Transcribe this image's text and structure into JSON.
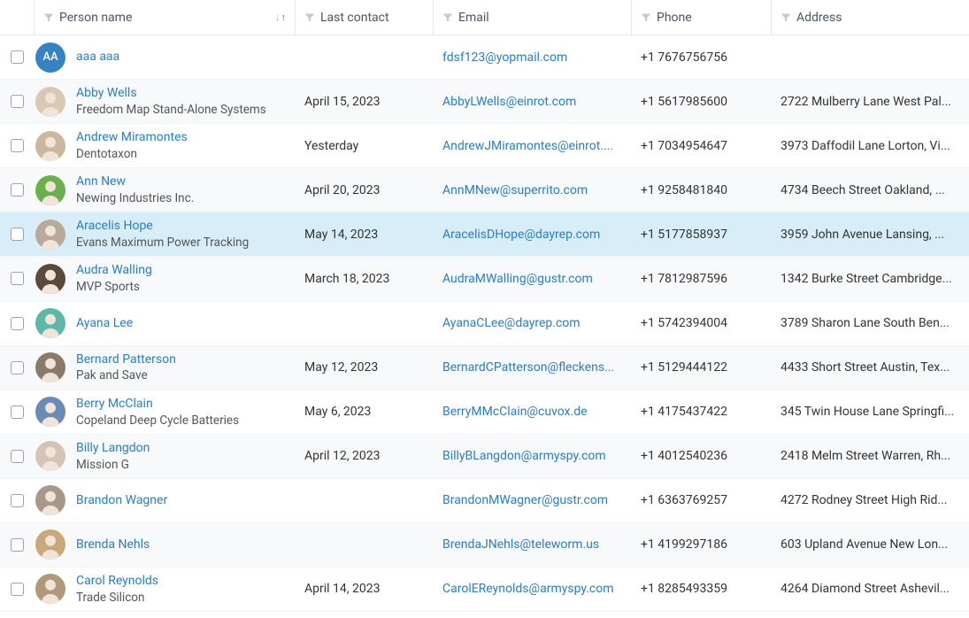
{
  "columns": {
    "person": "Person name",
    "lastContact": "Last contact",
    "email": "Email",
    "phone": "Phone",
    "address": "Address"
  },
  "rows": [
    {
      "initials": "AA",
      "avatarType": "initials",
      "avatarBg": "#3683c4",
      "name": "aaa aaa",
      "company": "",
      "lastContact": "",
      "email": "fdsf123@yopmail.com",
      "phone": "+1 7676756756",
      "address": "",
      "highlight": false
    },
    {
      "avatarType": "photo",
      "avatarBg": "#d8c9b5",
      "name": "Abby Wells",
      "company": "Freedom Map Stand-Alone Systems",
      "lastContact": "April 15, 2023",
      "email": "AbbyLWells@einrot.com",
      "phone": "+1 5617985600",
      "address": "2722 Mulberry Lane West Pal...",
      "highlight": false
    },
    {
      "avatarType": "photo",
      "avatarBg": "#c9b89e",
      "name": "Andrew Miramontes",
      "company": "Dentotaxon",
      "lastContact": "Yesterday",
      "email": "AndrewJMiramontes@einrot....",
      "phone": "+1 7034954647",
      "address": "3973 Daffodil Lane Lorton, Vi...",
      "highlight": false
    },
    {
      "avatarType": "photo",
      "avatarBg": "#6ab04c",
      "name": "Ann New",
      "company": "Newing Industries Inc.",
      "lastContact": "April 20, 2023",
      "email": "AnnMNew@superrito.com",
      "phone": "+1 9258481840",
      "address": "4734 Beech Street Oakland, ...",
      "highlight": false
    },
    {
      "avatarType": "photo",
      "avatarBg": "#b8a99a",
      "name": "Aracelis Hope",
      "company": "Evans Maximum Power Tracking",
      "lastContact": "May 14, 2023",
      "email": "AracelisDHope@dayrep.com",
      "phone": "+1 5177858937",
      "address": "3959 John Avenue Lansing, ...",
      "highlight": true
    },
    {
      "avatarType": "photo",
      "avatarBg": "#5a4a3a",
      "name": "Audra Walling",
      "company": "MVP Sports",
      "lastContact": "March 18, 2023",
      "email": "AudraMWalling@gustr.com",
      "phone": "+1 7812987596",
      "address": "1342 Burke Street Cambridge...",
      "highlight": false
    },
    {
      "avatarType": "photo",
      "avatarBg": "#5cb8a8",
      "name": "Ayana Lee",
      "company": "",
      "lastContact": "",
      "email": "AyanaCLee@dayrep.com",
      "phone": "+1 5742394004",
      "address": "3789 Sharon Lane South Ben...",
      "highlight": false
    },
    {
      "avatarType": "photo",
      "avatarBg": "#8a7a6a",
      "name": "Bernard Patterson",
      "company": "Pak and Save",
      "lastContact": "May 12, 2023",
      "email": "BernardCPatterson@fleckens...",
      "phone": "+1 5129444122",
      "address": "4433 Short Street Austin, Tex...",
      "highlight": false
    },
    {
      "avatarType": "photo",
      "avatarBg": "#6a8ab8",
      "name": "Berry McClain",
      "company": "Copeland Deep Cycle Batteries",
      "lastContact": "May 6, 2023",
      "email": "BerryMMcClain@cuvox.de",
      "phone": "+1 4175437422",
      "address": "345 Twin House Lane Springfi...",
      "highlight": false
    },
    {
      "avatarType": "photo",
      "avatarBg": "#d4c4b4",
      "name": "Billy Langdon",
      "company": "Mission G",
      "lastContact": "April 12, 2023",
      "email": "BillyBLangdon@armyspy.com",
      "phone": "+1 4012540236",
      "address": "2418 Melm Street Warren, Rh...",
      "highlight": false
    },
    {
      "avatarType": "photo",
      "avatarBg": "#a89888",
      "name": "Brandon Wagner",
      "company": "",
      "lastContact": "",
      "email": "BrandonMWagner@gustr.com",
      "phone": "+1 6363769257",
      "address": "4272 Rodney Street High Rid...",
      "highlight": false
    },
    {
      "avatarType": "photo",
      "avatarBg": "#c9a97a",
      "name": "Brenda Nehls",
      "company": "",
      "lastContact": "",
      "email": "BrendaJNehls@teleworm.us",
      "phone": "+1 4199297186",
      "address": "603 Upland Avenue New Lon...",
      "highlight": false
    },
    {
      "avatarType": "photo",
      "avatarBg": "#b09878",
      "name": "Carol Reynolds",
      "company": "Trade Silicon",
      "lastContact": "April 14, 2023",
      "email": "CarolEReynolds@armyspy.com",
      "phone": "+1 8285493359",
      "address": "4264 Diamond Street Ashevil...",
      "highlight": false
    }
  ]
}
